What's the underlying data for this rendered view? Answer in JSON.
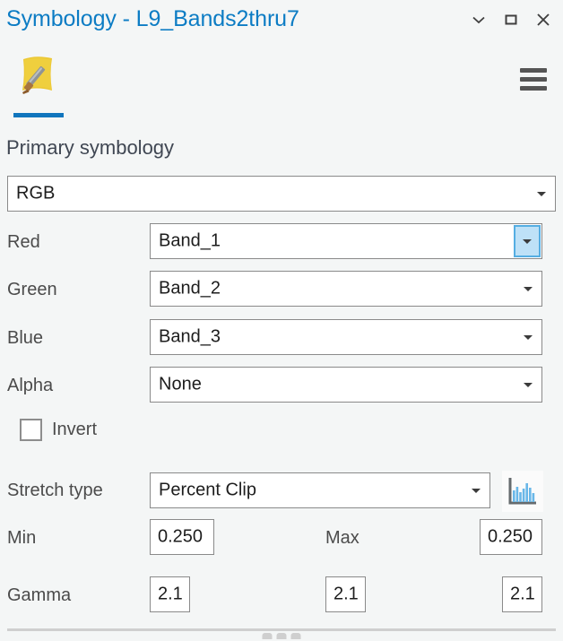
{
  "window": {
    "title": "Symbology - L9_Bands2thru7",
    "title_color": "#0c7cc4",
    "controls": [
      {
        "name": "chevron-down",
        "label": "Menu"
      },
      {
        "name": "maximize",
        "label": "Maximize"
      },
      {
        "name": "close",
        "label": "Close"
      }
    ]
  },
  "tabs": {
    "active_tab_name": "symbology-tab",
    "active_tab_icon": "symbology-brush-icon",
    "accent_color": "#1075bd",
    "menu_icon": "hamburger-menu-icon"
  },
  "main": {
    "heading": "Primary symbology",
    "primary_symbology": {
      "value": "RGB"
    },
    "channels": [
      {
        "label": "Red",
        "value": "Band_1",
        "highlighted": true
      },
      {
        "label": "Green",
        "value": "Band_2",
        "highlighted": false
      },
      {
        "label": "Blue",
        "value": "Band_3",
        "highlighted": false
      },
      {
        "label": "Alpha",
        "value": "None",
        "highlighted": false
      }
    ],
    "invert": {
      "label": "Invert",
      "checked": false
    },
    "stretch": {
      "label": "Stretch type",
      "value": "Percent Clip",
      "histogram_button": "histogram-icon"
    },
    "min": {
      "label": "Min",
      "value": "0.250"
    },
    "max": {
      "label": "Max",
      "value": "0.250"
    },
    "gamma": {
      "label": "Gamma",
      "values": [
        "2.1",
        "2.1",
        "2.1"
      ]
    }
  },
  "colors": {
    "background": "#f4f6f6",
    "field_border": "#8a8a8a",
    "highlight_fill": "#bee1f7",
    "highlight_border": "#55aee2",
    "histogram_bar": "#69b7e8"
  }
}
